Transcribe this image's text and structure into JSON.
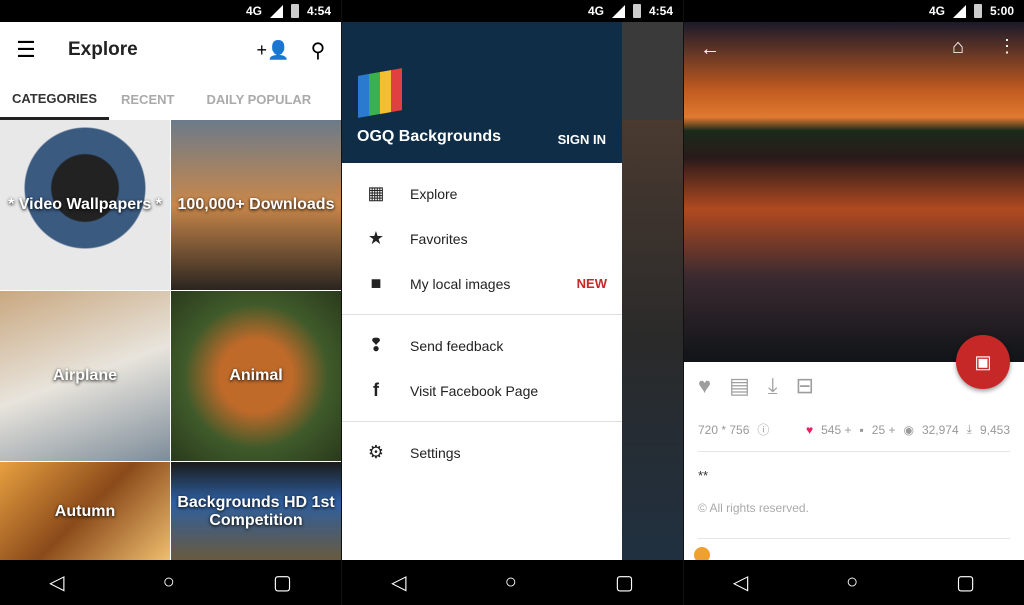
{
  "panels": [
    {
      "status": {
        "network": "4G",
        "time": "4:54"
      }
    },
    {
      "status": {
        "network": "4G",
        "time": "4:54"
      }
    },
    {
      "status": {
        "network": "4G",
        "time": "5:00"
      }
    }
  ],
  "explore": {
    "title": "Explore",
    "tabs": [
      "CATEGORIES",
      "RECENT",
      "DAILY POPULAR"
    ],
    "categories": [
      "* Video Wallpapers *",
      "100,000+ Downloads",
      "Airplane",
      "Animal",
      "Autumn",
      "Backgrounds HD 1st Competition"
    ]
  },
  "drawer": {
    "app_name": "OGQ Backgrounds",
    "sign_in": "SIGN IN",
    "items": [
      {
        "icon": "grid-icon",
        "label": "Explore"
      },
      {
        "icon": "star-icon",
        "label": "Favorites"
      },
      {
        "icon": "folder-icon",
        "label": "My local images",
        "badge": "NEW"
      },
      {
        "icon": "feedback-icon",
        "label": "Send feedback"
      },
      {
        "icon": "facebook-icon",
        "label": "Visit Facebook Page"
      },
      {
        "icon": "gear-icon",
        "label": "Settings"
      }
    ],
    "badge_color": "#c62828"
  },
  "detail": {
    "resolution": "720 * 756",
    "likes": "545 +",
    "comments": "25 +",
    "views": "32,974",
    "downloads": "9,453",
    "description": "**",
    "copyright": "All rights reserved.",
    "fab_color": "#c62828"
  }
}
